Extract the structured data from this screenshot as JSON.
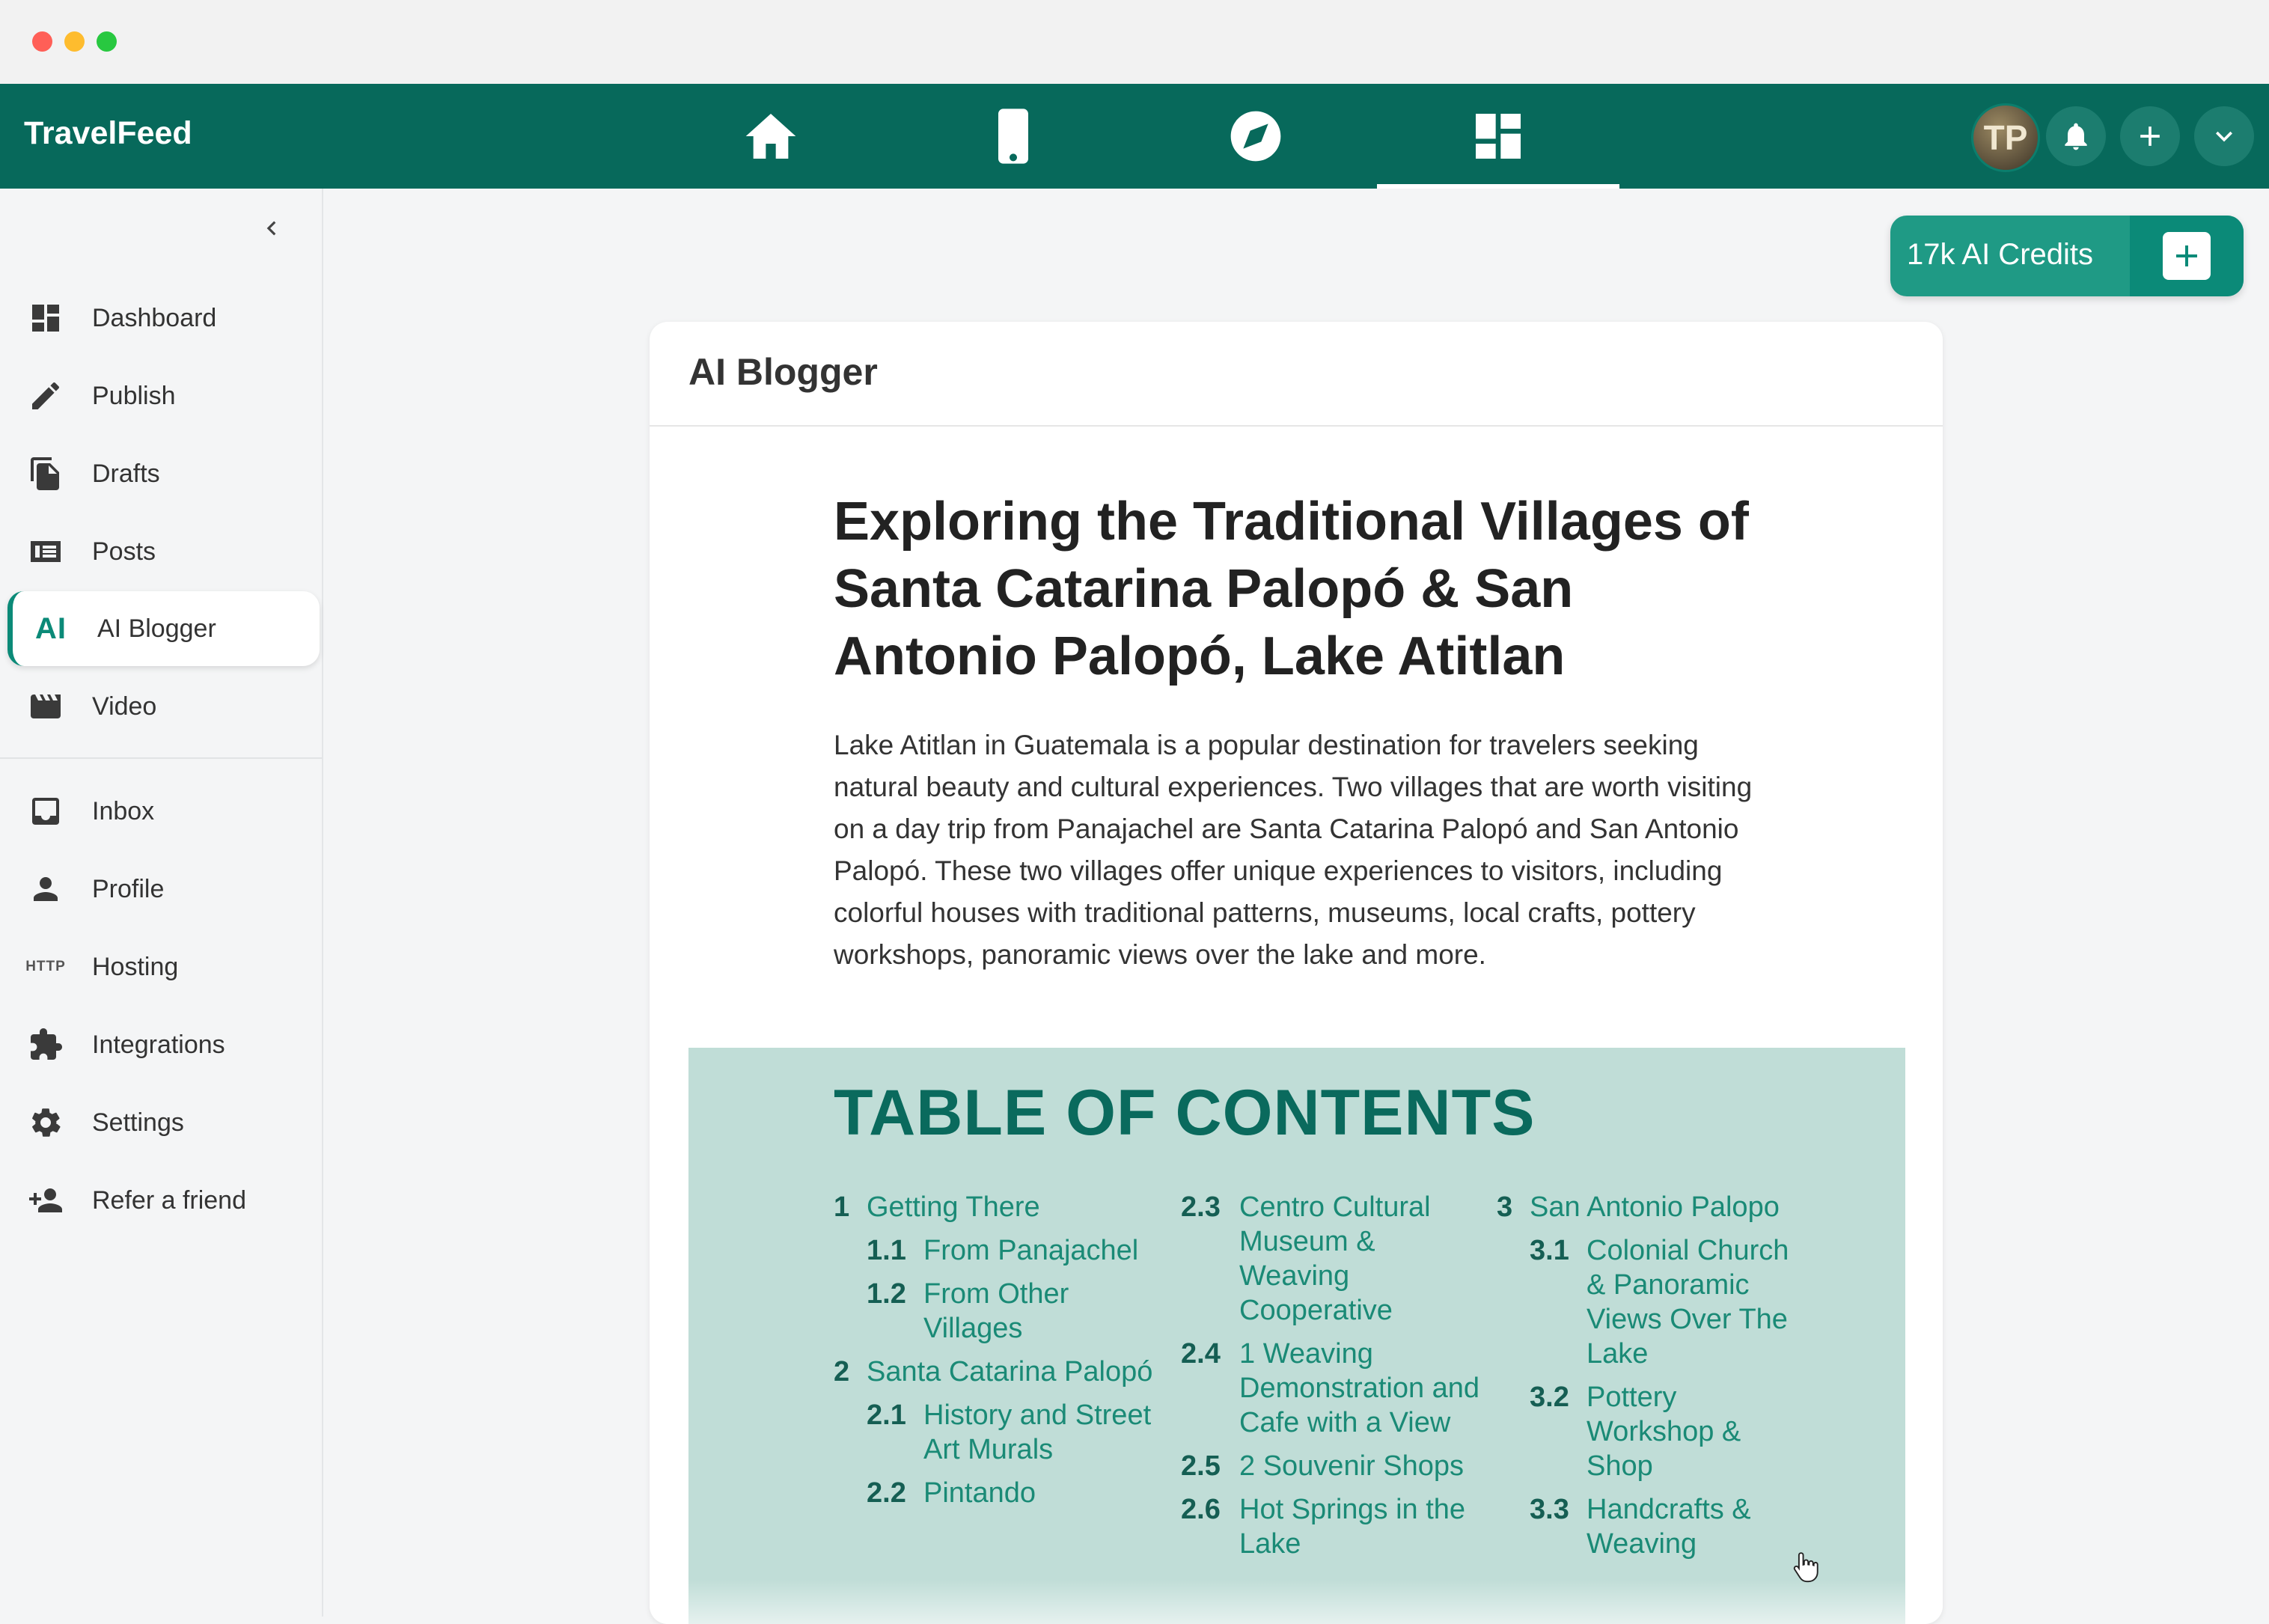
{
  "app": {
    "brand": "TravelFeed"
  },
  "topnav": {
    "items": [
      {
        "id": "home",
        "icon": "home-icon"
      },
      {
        "id": "mobile",
        "icon": "smartphone-icon"
      },
      {
        "id": "explore",
        "icon": "compass-icon"
      },
      {
        "id": "dashboard",
        "icon": "dashboard-icon",
        "active": true
      }
    ],
    "avatar_initials": "TP"
  },
  "sidebar": {
    "items": [
      {
        "label": "Dashboard",
        "icon": "dashboard-icon"
      },
      {
        "label": "Publish",
        "icon": "pencil-icon"
      },
      {
        "label": "Drafts",
        "icon": "drafts-icon"
      },
      {
        "label": "Posts",
        "icon": "posts-icon"
      },
      {
        "label": "AI Blogger",
        "icon": "ai-icon",
        "icon_text": "AI",
        "active": true
      },
      {
        "label": "Video",
        "icon": "video-icon"
      },
      {
        "label": "Inbox",
        "icon": "inbox-icon"
      },
      {
        "label": "Profile",
        "icon": "person-icon"
      },
      {
        "label": "Hosting",
        "icon": "http-icon",
        "icon_text": "HTTP"
      },
      {
        "label": "Integrations",
        "icon": "puzzle-icon"
      },
      {
        "label": "Settings",
        "icon": "gear-icon"
      },
      {
        "label": "Refer a friend",
        "icon": "add-person-icon"
      }
    ]
  },
  "credits": {
    "label": "17k AI Credits"
  },
  "card": {
    "title": "AI Blogger",
    "headline": "Exploring the Traditional Villages of Santa Catarina Palopó & San Antonio Palopó, Lake Atitlan",
    "intro": "Lake Atitlan in Guatemala is a popular destination for travelers seeking natural beauty and cultural experiences. Two villages that are worth visiting on a day trip from Panajachel are Santa Catarina Palopó and San Antonio Palopó. These two villages offer unique experiences to visitors, including colorful houses with traditional patterns, museums, local crafts, pottery workshops, panoramic views over the lake and more.",
    "toc": {
      "title": "TABLE OF CONTENTS",
      "columns": [
        [
          {
            "num": "1",
            "text": "Getting There",
            "level": 1
          },
          {
            "num": "1.1",
            "text": "From Panajachel",
            "level": 2
          },
          {
            "num": "1.2",
            "text": "From Other Villages",
            "level": 2
          },
          {
            "num": "2",
            "text": "Santa Catarina Palopó",
            "level": 1
          },
          {
            "num": "2.1",
            "text": "History and Street Art Murals",
            "level": 2
          },
          {
            "num": "2.2",
            "text": "Pintando",
            "level": 2
          }
        ],
        [
          {
            "num": "2.3",
            "text": "Centro Cultural Museum & Weaving Cooperative",
            "level": 1
          },
          {
            "num": "2.4",
            "text": "1 Weaving Demonstration and Cafe with a View",
            "level": 1
          },
          {
            "num": "2.5",
            "text": "2 Souvenir Shops",
            "level": 1
          },
          {
            "num": "2.6",
            "text": "Hot Springs in the Lake",
            "level": 1
          }
        ],
        [
          {
            "num": "3",
            "text": "San Antonio Palopo",
            "level": 1
          },
          {
            "num": "3.1",
            "text": "Colonial Church & Panoramic Views Over The Lake",
            "level": 2
          },
          {
            "num": "3.2",
            "text": "Pottery Workshop & Shop",
            "level": 2
          },
          {
            "num": "3.3",
            "text": "Handcrafts & Weaving",
            "level": 2
          }
        ]
      ]
    }
  },
  "colors": {
    "primary": "#07695b",
    "accent": "#0b8a78",
    "toc_bg": "#c0ddd7"
  }
}
